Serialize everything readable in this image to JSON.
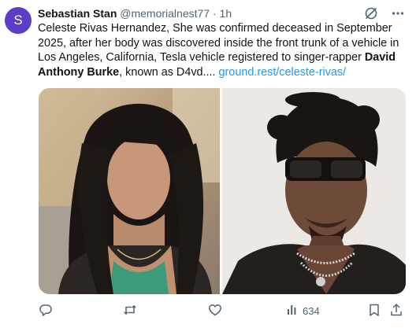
{
  "tweet": {
    "avatar_letter": "S",
    "author_name": "Sebastian Stan",
    "handle": "@memorialnest77",
    "separator": "·",
    "time": "1h",
    "text_parts": {
      "p1": "Celeste Rivas Hernandez, She was confirmed deceased in September 2025, after her body was discovered inside the front trunk of a vehicle in Los Angeles, California, Tesla vehicle registered to singer-rapper ",
      "bold": "David Anthony Burke",
      "p2": ",  known as D4vd.... ",
      "link": "ground.rest/celeste-rivas/"
    },
    "views": "634"
  },
  "icons": {
    "top": [
      "grok-icon",
      "more-options-icon"
    ],
    "actions": [
      "reply-icon",
      "retweet-icon",
      "like-icon",
      "views-icon",
      "bookmark-icon",
      "share-icon"
    ]
  },
  "colors": {
    "avatar": "#5b3dc8",
    "link": "#1d9bf0",
    "muted": "#536471",
    "text": "#0f1419"
  }
}
